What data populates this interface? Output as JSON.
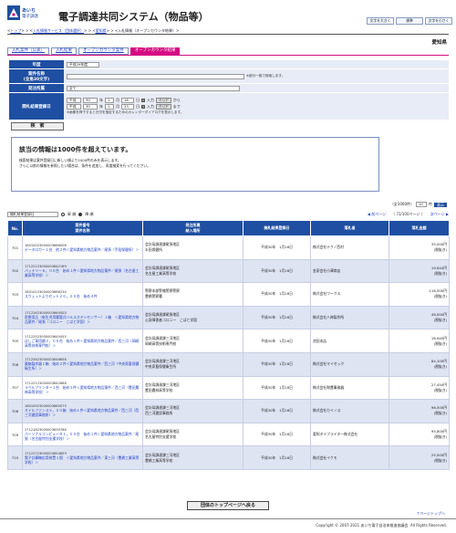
{
  "header": {
    "logo_line1": "あいち",
    "logo_line2": "電子調達",
    "system_title": "電子調達共同システム（物品等）",
    "font_large": "文字を大きく",
    "font_standard": "標準",
    "font_small": "文字を小さく"
  },
  "breadcrumb": {
    "items": [
      "トップ",
      "入札情報サービス（団体選択）",
      "愛知県",
      "入札情報（オープンカウンタ結果）"
    ]
  },
  "region": "愛知県",
  "tabs": [
    "入札案件（公表）",
    "入札結果",
    "オープンカウンタ案件",
    "オープンカウンタ結果"
  ],
  "form": {
    "year_label": "年度",
    "year_value": "平成29年度",
    "name_label": "案件名称",
    "name_sub": "(全角30文字)",
    "name_note": "※部分一致で検索します。",
    "org_label": "発注所属",
    "org_value": "全て",
    "date_label": "開札結果登録日",
    "era1": "平成",
    "y1": "30",
    "m1": "1",
    "d1": "16",
    "era2": "平成",
    "y2": "30",
    "m2": "1",
    "d2": "23",
    "year_unit": "年",
    "month_unit": "月",
    "day_unit": "日",
    "from_label": "から",
    "to_label": "まで",
    "calendar_label": "入力",
    "clear_label": "クリア",
    "calendar_note": "※画像を押下すると日付を指定するためのカレンダーダイアログを表示します。",
    "search_label": "検　索"
  },
  "message": {
    "title": "該当の情報は1000件を超えています。",
    "line1": "検索結果は案件登録日に新しい順より1000件のみを表示します。",
    "line2": "さらに以前の情報を参照したい場合は、条件を追加し、再度検索を行ってください。"
  },
  "pager": {
    "total": "（全1000件）",
    "per_page": "10",
    "per_unit": "件",
    "go": "表示",
    "prev": "前ページ",
    "page_info": "（ 71/100ページ ）",
    "next": "次ページ"
  },
  "sort": {
    "field": "開札結果登録日",
    "asc": "昇 順",
    "desc": "降 順"
  },
  "table": {
    "headers": [
      "No.",
      "案件番号\n案件名称",
      "発注所属\n納入場所",
      "開札結果登録日",
      "落札者",
      "落札金額"
    ],
    "rows": [
      {
        "no": "701",
        "code": "18010023000003666006",
        "name": "データロガー１台　他２件＜愛知県統方物品案件／尾張（手段保健所）＞",
        "org": "会計局調達課尾張地区",
        "place": "半田保健所",
        "date": "平成30年　1月16日",
        "winner": "株式会社テクノ西村",
        "amount": "35,000円",
        "amount_note": "(税抜き)"
      },
      {
        "no": "702",
        "code": "17122123000003642169",
        "name": "バッテリー６，００台　始め１件＜愛知県地方物品案件／尾張（名古屋工業高等学校）＞",
        "org": "会計局調達課尾張地区",
        "place": "名古屋工業高等学校",
        "date": "平成30年　1月16日",
        "winner": "金豪会社小澤商店",
        "amount": "19,644円",
        "amount_note": "(税抜き)"
      },
      {
        "no": "703",
        "code": "18010123000003666234",
        "name": "スウェットよりセット２０，００台　始め４件",
        "org": "警察本部警備警察警察",
        "place": "豊橋警察署",
        "date": "平成30年　1月16日",
        "winner": "株式会社ワークス",
        "amount": "116,000円",
        "amount_note": "(税抜き)"
      },
      {
        "no": "704",
        "code": "17122623000003664503",
        "name": "医療用品（新生児用腸管式バルスオキシセンサー）１箱　＜愛知県地方物品案件／尾張（コロニー　こばと学園）＞",
        "org": "会計局調達課尾張地区",
        "place": "心身障害者コロニー　こばと学園",
        "date": "平成30年　1月16日",
        "winner": "株式会社八神製作所",
        "amount": "46,000円",
        "amount_note": "(税抜き)"
      },
      {
        "no": "705",
        "code": "17122523000003645455",
        "name": "はしご車用鋼３，００台　始め１件＜愛知県地方物品案件／西三河（岡崎高等技術専門校）＞",
        "org": "会計局調達課三河地区",
        "place": "岡崎高等技術専門校",
        "date": "平成30年　1月16日",
        "winner": "池田本店",
        "amount": "16,940円",
        "amount_note": "(税抜き)"
      },
      {
        "no": "706",
        "code": "17122623000003646658",
        "name": "薬箱製作器１箱　始め２件＜愛知県地方物品案件／西三河（中央家畜保健衛生所）＞",
        "org": "会計局調達課三河地区",
        "place": "中央家畜保健衛生所",
        "date": "平成30年　1月16日",
        "winner": "株式会社マイセック",
        "amount": "84,100円",
        "amount_note": "(税抜き)"
      },
      {
        "no": "707",
        "code": "17122123000003642668",
        "name": "ラベルプリンター１台　始め５件＜愛知県地方物品案件／西三河（豊田農林高等学校）＞",
        "org": "会計局調達課三河地区",
        "place": "豊田農林高等学校",
        "date": "平成30年　1月16日",
        "winner": "株式会社和豊事務器",
        "amount": "27,450円",
        "amount_note": "(税抜き)"
      },
      {
        "no": "708",
        "code": "18010923000003665075",
        "name": "オイルファンス５，００箱　始め１件＜愛知県地方物品案件／西三河（西三河建設事務所）＞",
        "org": "会計局調達課三河地区",
        "place": "西三河建設事務所",
        "date": "平成30年　1月16日",
        "winner": "株式会社カイノス",
        "amount": "98,500円",
        "amount_note": "(税抜き)"
      },
      {
        "no": "709",
        "code": "17121823000003639786",
        "name": "パーソナルコンピュータ１，００台　始め１件＜愛知県地方物品案件／尾張（名古屋特別支援学校）＞",
        "org": "会計局調達課尾張地区",
        "place": "名古屋特別支援学校",
        "date": "平成30年　1月16日",
        "winner": "愛知タイプライター株式会社",
        "amount": "95,800円",
        "amount_note": "(税抜き)"
      },
      {
        "no": "710",
        "code": "17122723000003654659",
        "name": "電子計算機応用装置１個　＜愛知県地方物品案件／東三河（豊橋工業高等学校）＞",
        "org": "会計局調達課三河地区",
        "place": "豊橋工業高等学校",
        "date": "平成30年　1月16日",
        "winner": "株式会社イクモ",
        "amount": "25,000円",
        "amount_note": "(税抜き)"
      }
    ]
  },
  "footer": {
    "top_button": "団体のトップページへ戻る",
    "page_top": "↑ページトップへ",
    "copyright": "Copyright © 2007-2021 あいち電子自治体推進協議会. All Rights Reserved."
  },
  "colors": {
    "brand_blue": "#1f4fa2",
    "accent_pink": "#d40c82"
  }
}
